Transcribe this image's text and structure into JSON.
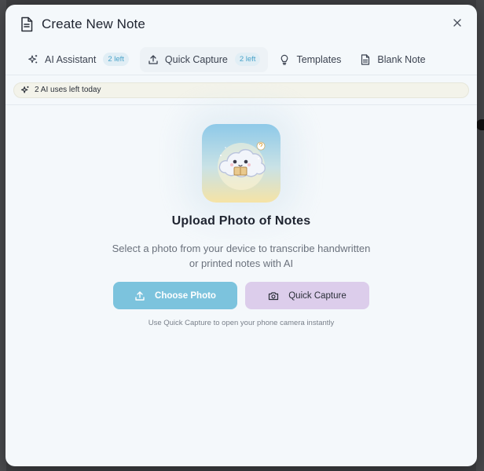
{
  "modal": {
    "title": "Create New Note",
    "icons": {
      "title_icon": "document-icon",
      "close_icon": "close-icon"
    }
  },
  "tabs": [
    {
      "label": "AI Assistant",
      "badge": "2 left",
      "icon": "sparkles-icon",
      "active": false
    },
    {
      "label": "Quick Capture",
      "badge": "2 left",
      "icon": "upload-icon",
      "active": true
    },
    {
      "label": "Templates",
      "icon": "lightbulb-icon",
      "active": false
    },
    {
      "label": "Blank Note",
      "icon": "document-icon",
      "active": false
    }
  ],
  "usage": {
    "text": "2 AI uses left today",
    "icon": "sparkles-icon"
  },
  "upload": {
    "title": "Upload Photo of Notes",
    "description": "Select a photo from your device to transcribe handwritten or printed notes with AI",
    "choose_button": "Choose Photo",
    "capture_button": "Quick Capture",
    "hint": "Use Quick Capture to open your phone camera instantly"
  },
  "colors": {
    "accent": "#7cc3dd",
    "secondary": "#dccdeb",
    "background": "#f4f8fb",
    "badge_text": "#4aa3c9"
  }
}
